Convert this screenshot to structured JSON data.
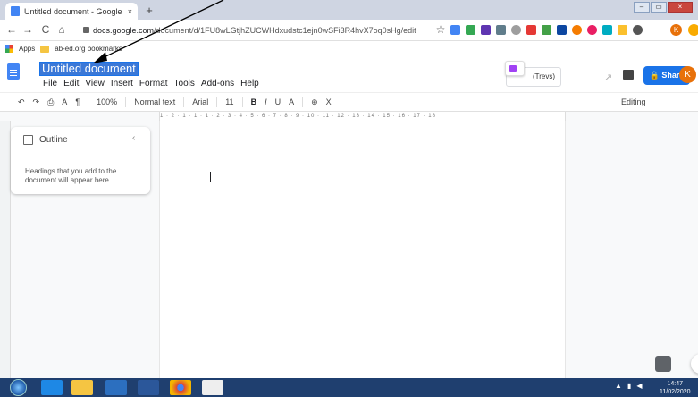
{
  "browser": {
    "tab_title": "Untitled document - Google Doc",
    "tab_close": "×",
    "new_tab": "+",
    "window_min": "–",
    "window_max": "▭",
    "window_close": "×",
    "nav_back": "←",
    "nav_forward": "→",
    "nav_reload": "C",
    "nav_home": "⌂",
    "url_host": "docs.google.com",
    "url_path": "/document/d/1FU8wLGtjhZUCWHdxudstc1ejn0wSFi3R4hvX7oq0sHg/edit",
    "star": "☆",
    "profile_initial": "K"
  },
  "bookmarks": {
    "apps_label": "Apps",
    "item_label": "ab-ed.org bookmarks"
  },
  "docs": {
    "title": "Untitled document",
    "menu": [
      "File",
      "Edit",
      "View",
      "Insert",
      "Format",
      "Tools",
      "Add-ons",
      "Help"
    ],
    "chip_label": "(Trevs)",
    "trend_icon": "↗",
    "share_label": "Share",
    "share_icon": "🔒",
    "avatar_initial": "K",
    "editing_label": "Editing"
  },
  "toolbar": {
    "undo": "↶",
    "redo": "↷",
    "print": "⎙",
    "spell": "A",
    "paint": "¶",
    "zoom": "100%",
    "style": "Normal text",
    "font": "Arial",
    "size": "11",
    "bold": "B",
    "italic": "I",
    "underline": "U",
    "text_color": "A",
    "link": "⊕",
    "clear": "X"
  },
  "ruler_text": "1 · 2 · 1 · 1 · 1 · 2 · 3 · 4 · 5 · 6 · 7 · 8 · 9 · 10 · 11 · 12 · 13 · 14 · 15 · 16 · 17 · 18",
  "outline": {
    "title": "Outline",
    "close": "‹",
    "hint": "Headings that you add to the document will appear here."
  },
  "taskbar": {
    "time": "14:47",
    "date": "11/02/2020"
  },
  "colors": {
    "accent": "#1a73e8",
    "docs_blue": "#4285f4",
    "avatar": "#e8710a",
    "taskbar": "#1f3f6f"
  }
}
